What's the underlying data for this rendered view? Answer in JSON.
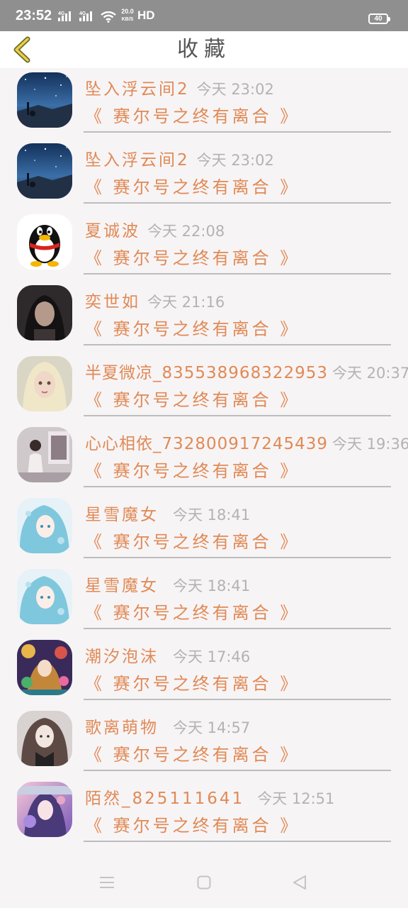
{
  "status_bar": {
    "time": "23:52",
    "signal_a": "4G",
    "signal_b": "4G",
    "speed_value": "20.0",
    "speed_unit": "KB/S",
    "hd": "HD",
    "battery": "40"
  },
  "header": {
    "title": "收藏",
    "accent_color": "#e08a55"
  },
  "items": [
    {
      "name": "坠入浮云间2",
      "time": "今天 23:02",
      "book": "《 赛尔号之终有离合 》",
      "avatar": "night-sky-avatar"
    },
    {
      "name": "坠入浮云间2",
      "time": "今天 23:02",
      "book": "《 赛尔号之终有离合 》",
      "avatar": "night-sky-avatar"
    },
    {
      "name": "夏诚波",
      "time": "今天 22:08",
      "book": "《 赛尔号之终有离合 》",
      "avatar": "penguin-avatar"
    },
    {
      "name": "奕世如",
      "time": "今天 21:16",
      "book": "《 赛尔号之终有离合 》",
      "avatar": "dark-portrait-avatar"
    },
    {
      "name": "半夏微凉_835538968322953",
      "time": "今天 20:37",
      "book": "《 赛尔号之终有离合 》",
      "avatar": "doll-avatar"
    },
    {
      "name": "心心相依_732800917245439",
      "time": "今天 19:36",
      "book": "《 赛尔号之终有离合 》",
      "avatar": "room-photo-avatar"
    },
    {
      "name": "星雪魔女",
      "time": "今天 18:41",
      "book": "《 赛尔号之终有离合 》",
      "avatar": "blue-anime-avatar"
    },
    {
      "name": "星雪魔女",
      "time": "今天 18:41",
      "book": "《 赛尔号之终有离合 》",
      "avatar": "blue-anime-avatar"
    },
    {
      "name": "潮汐泡沫",
      "time": "今天 17:46",
      "book": "《 赛尔号之终有离合 》",
      "avatar": "colorful-anime-avatar"
    },
    {
      "name": "歌离萌物",
      "time": "今天 14:57",
      "book": "《 赛尔号之终有离合 》",
      "avatar": "sketch-anime-avatar"
    },
    {
      "name": "陌然_825111641",
      "time": "今天 12:51",
      "book": "《 赛尔号之终有离合 》",
      "avatar": "purple-anime-avatar"
    }
  ]
}
